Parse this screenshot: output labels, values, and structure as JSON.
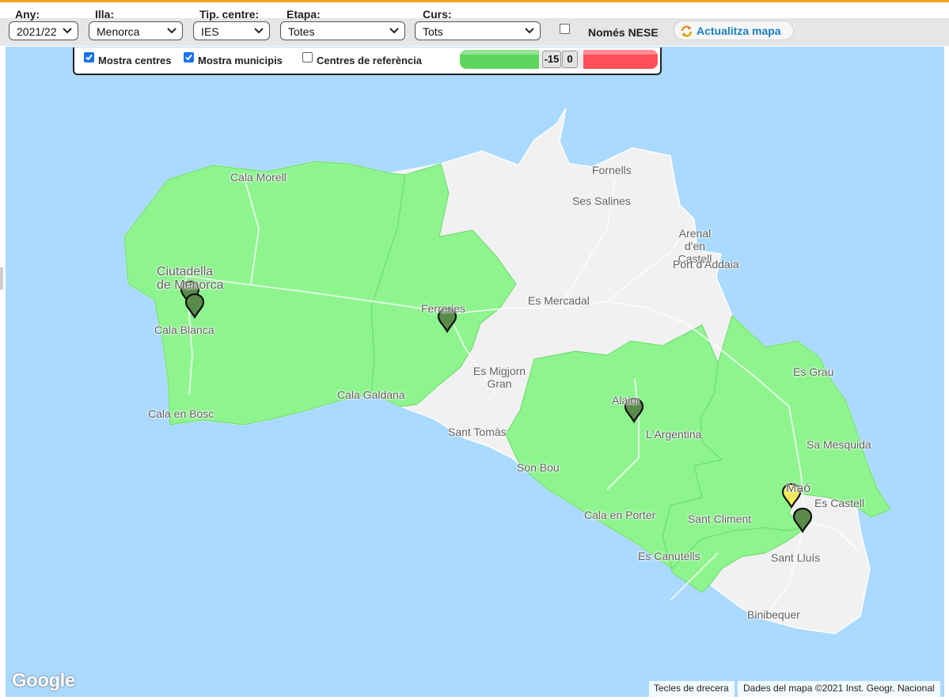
{
  "filters": {
    "any": {
      "label": "Any:",
      "value": "2021/22"
    },
    "illa": {
      "label": "Illa:",
      "value": "Menorca"
    },
    "tip_centre": {
      "label": "Tip. centre:",
      "value": "IES"
    },
    "etapa": {
      "label": "Etapa:",
      "value": "Totes"
    },
    "curs": {
      "label": "Curs:",
      "value": "Tots"
    },
    "nomes_nese": {
      "label": "Només NESE",
      "checked": false
    },
    "refresh_label": "Actualitza mapa"
  },
  "overlay": {
    "mostra_centres": {
      "label": "Mostra centres",
      "checked": true
    },
    "mostra_municipis": {
      "label": "Mostra municipis",
      "checked": true
    },
    "centres_referencia": {
      "label": "Centres de referència",
      "checked": false
    },
    "range_min": "-15",
    "range_max": "0"
  },
  "map": {
    "places": [
      "Cala Morell",
      "Fornells",
      "Ses Salines",
      "Arenal d'en Castell",
      "Port d'Addaia",
      "Ciutadella de Menorca",
      "Ferreries",
      "Es Mercadal",
      "Cala Blanca",
      "Es Migjorn Gran",
      "Alaior",
      "Es Grau",
      "Cala Galdana",
      "Cala en Bosc",
      "Sant Tomàs",
      "L'Argentina",
      "Sa Mesquida",
      "Son Bou",
      "Maó",
      "Es Castell",
      "Cala en Porter",
      "Sant Climent",
      "Es Canutells",
      "Sant Lluís",
      "Binibequer"
    ],
    "logo": "Google",
    "shortcuts": "Tecles de drecera",
    "attribution": "Dades del mapa ©2021 Inst. Geogr. Nacional"
  },
  "colors": {
    "land_good": "#8ef58e",
    "land_neutral": "#f1f1f1",
    "water": "#aadaff",
    "accent": "#f5a623",
    "link": "#1a7fc1"
  }
}
